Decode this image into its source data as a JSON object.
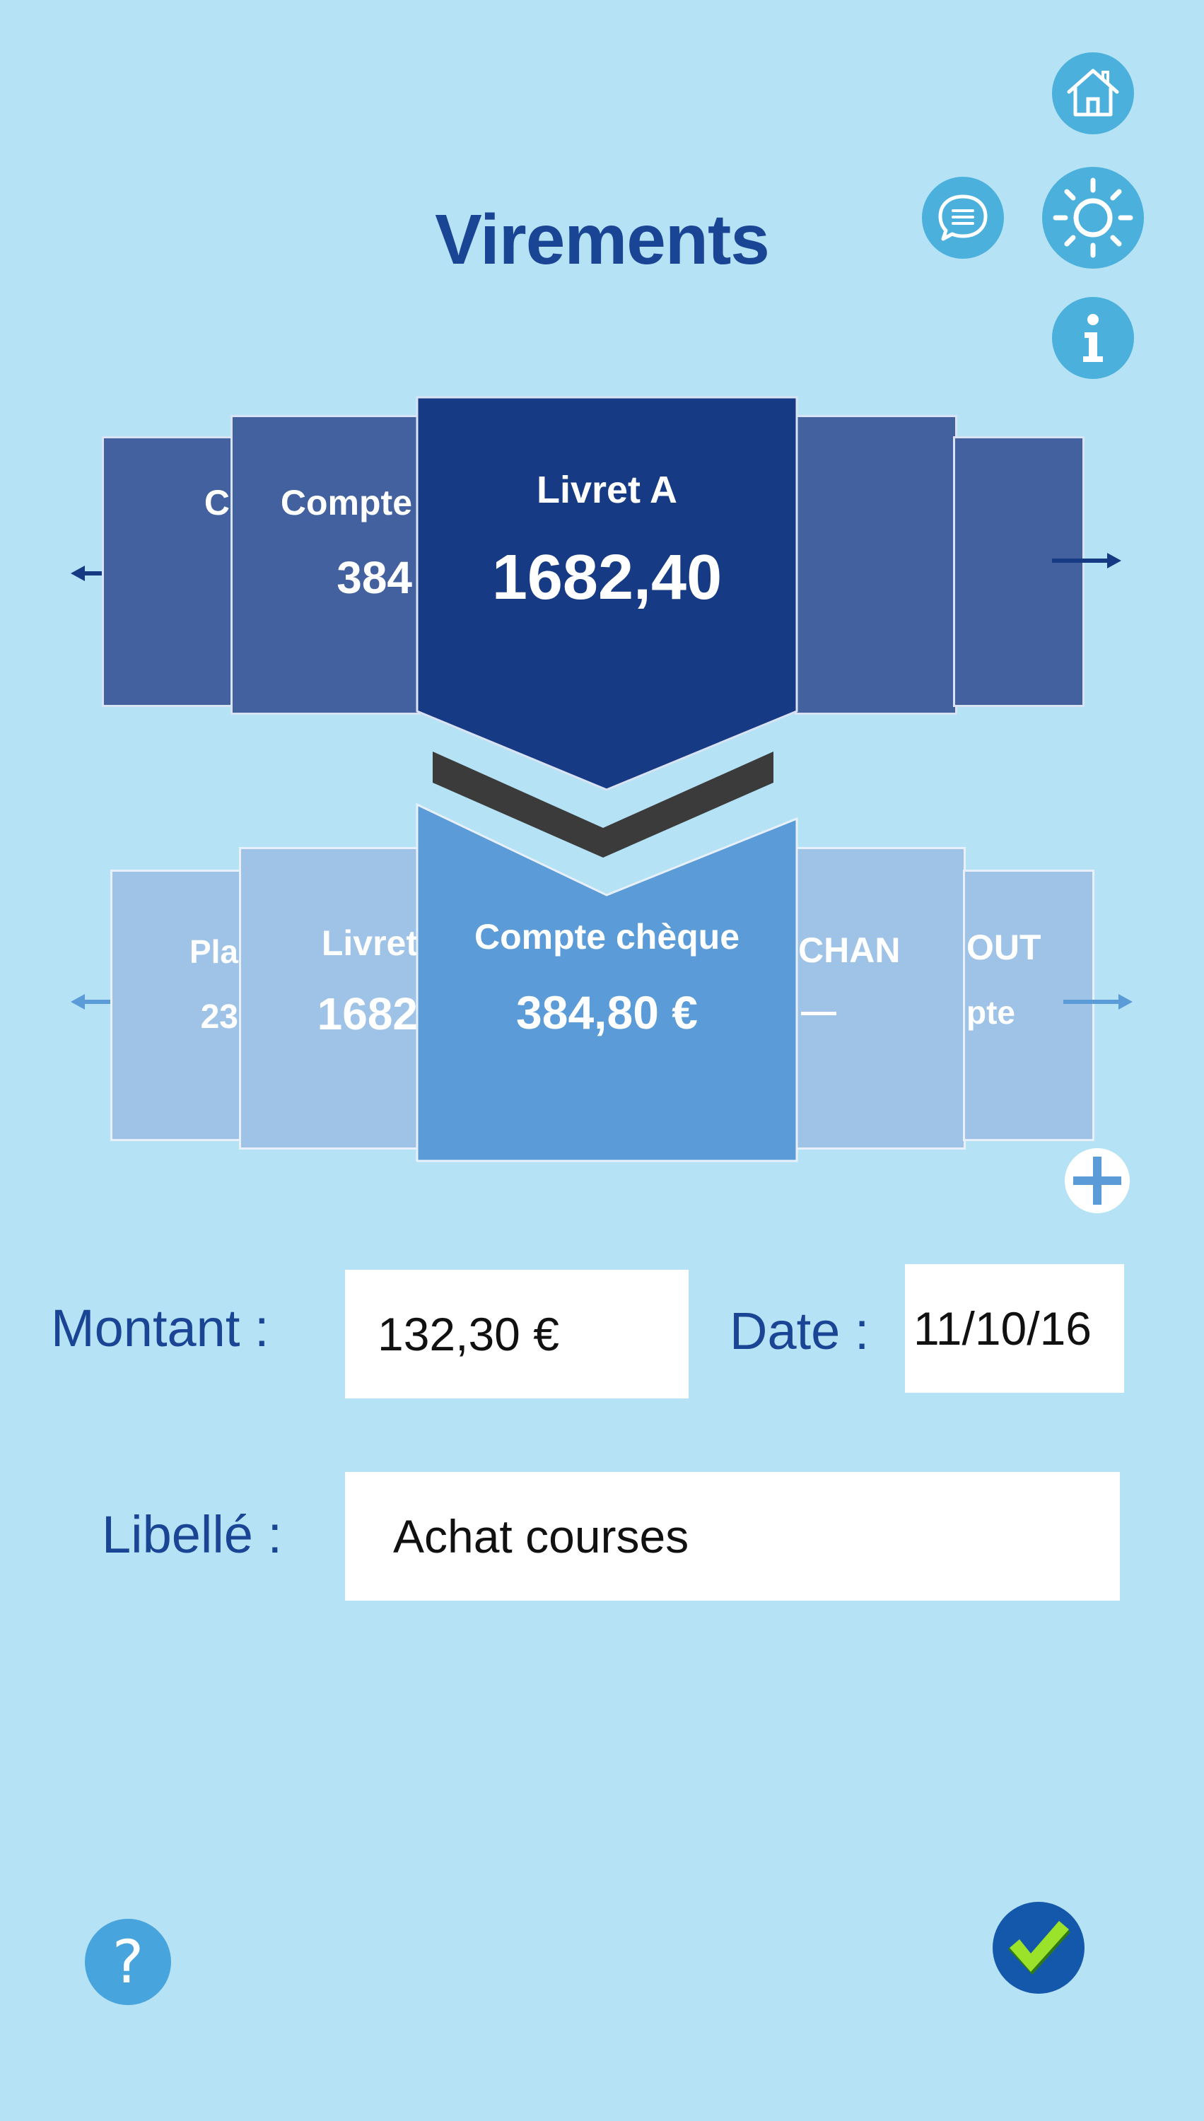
{
  "page": {
    "title": "Virements"
  },
  "header_icons": [
    "home-icon",
    "chat-icon",
    "brightness-icon",
    "info-icon"
  ],
  "source_accounts": {
    "far_left": {
      "label": "C"
    },
    "left": {
      "label": "Compte",
      "value": "384"
    },
    "selected": {
      "label": "Livret A",
      "value": "1682,40"
    }
  },
  "destination_accounts": {
    "far_left": {
      "label": "Pla",
      "value": "23"
    },
    "left": {
      "label": "Livret",
      "value": "1682"
    },
    "selected": {
      "label": "Compte chèque",
      "value": "384,80 €"
    },
    "right": {
      "label": "CHAN",
      "value": "—"
    },
    "far_right": {
      "label": "OUT",
      "value": "pte"
    }
  },
  "form": {
    "amount_label": "Montant :",
    "amount_value": "132,30 €",
    "date_label": "Date :",
    "date_value": "11/10/16",
    "wording_label": "Libellé :",
    "wording_value": "Achat courses"
  },
  "footer": {
    "help_symbol": "?"
  },
  "colors": {
    "background": "#b5e2f5",
    "title": "#1a4494",
    "source_selected": "#173a85",
    "source_side": "#43609f",
    "destination_selected": "#5b9bd7",
    "destination_side": "#9fc3e6",
    "icon_button": "#4bb1dc",
    "confirm_check": "#9be22b"
  }
}
